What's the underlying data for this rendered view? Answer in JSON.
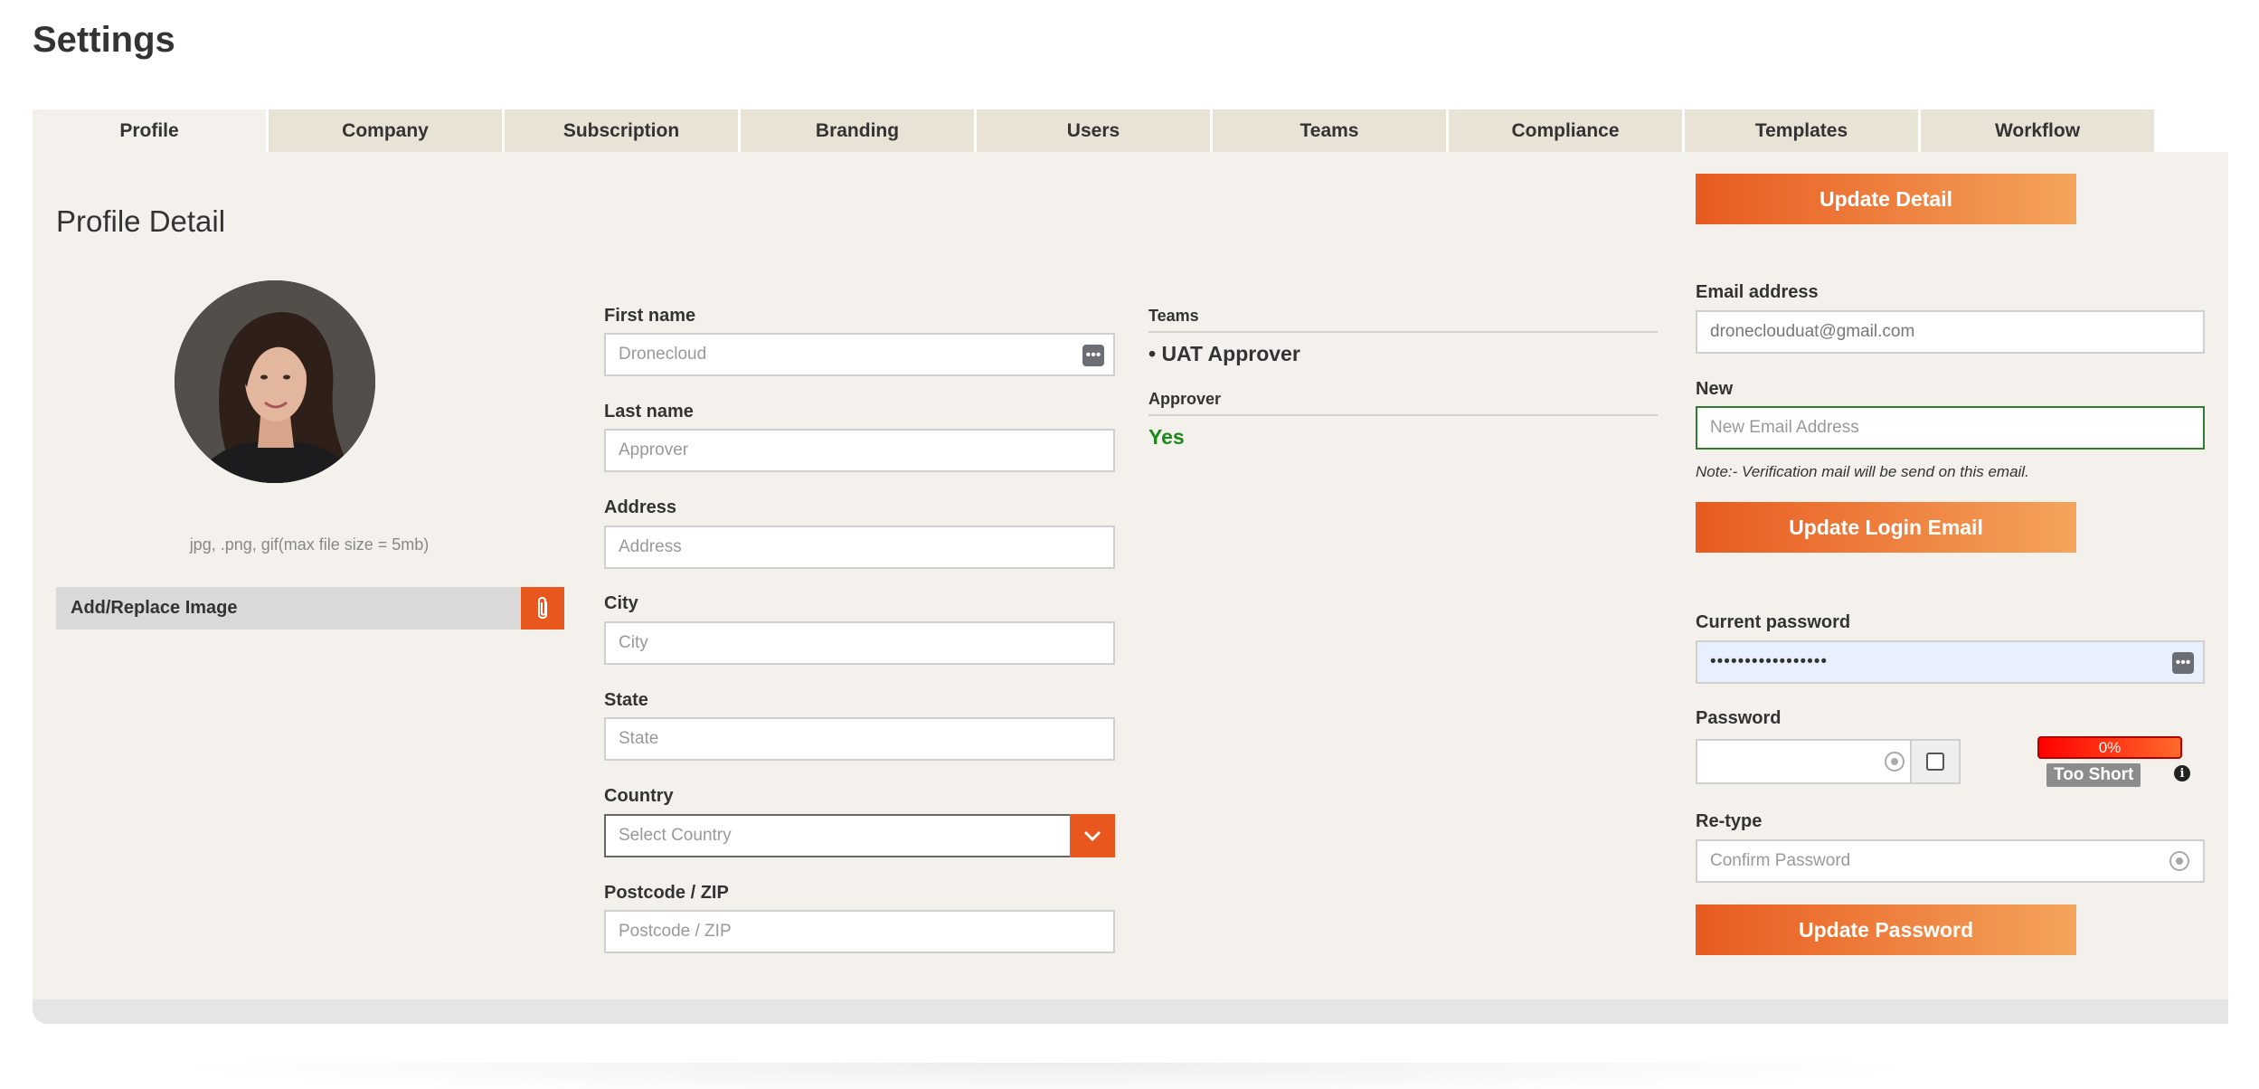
{
  "page": {
    "title": "Settings"
  },
  "tabs": [
    {
      "label": "Profile"
    },
    {
      "label": "Company"
    },
    {
      "label": "Subscription"
    },
    {
      "label": "Branding"
    },
    {
      "label": "Users"
    },
    {
      "label": "Teams"
    },
    {
      "label": "Compliance"
    },
    {
      "label": "Templates"
    },
    {
      "label": "Workflow"
    }
  ],
  "active_tab": "Profile",
  "profile": {
    "section_title": "Profile Detail",
    "file_hint": "jpg, .png, gif(max file size = 5mb)",
    "upload_label": "Add/Replace Image",
    "upload_icon": "paperclip-icon"
  },
  "form": {
    "first_name": {
      "label": "First name",
      "placeholder": "Dronecloud"
    },
    "last_name": {
      "label": "Last name",
      "placeholder": "Approver"
    },
    "address": {
      "label": "Address",
      "placeholder": "Address"
    },
    "city": {
      "label": "City",
      "placeholder": "City"
    },
    "state": {
      "label": "State",
      "placeholder": "State"
    },
    "country": {
      "label": "Country",
      "placeholder": "Select Country"
    },
    "postcode": {
      "label": "Postcode / ZIP",
      "placeholder": "Postcode / ZIP"
    }
  },
  "teams": {
    "label": "Teams",
    "value": "• UAT Approver",
    "approver_label": "Approver",
    "approver_value": "Yes"
  },
  "account": {
    "update_detail_label": "Update Detail",
    "email_label": "Email address",
    "email_value": "droneclouduat@gmail.com",
    "new_email_label": "New",
    "new_email_placeholder": "New Email Address",
    "note": "Note:- Verification mail will be send on this email.",
    "update_email_label": "Update Login Email",
    "current_password_label": "Current password",
    "current_password_value": "•••••••••••••••••",
    "password_label": "Password",
    "strength_percent": "0%",
    "strength_text": "Too Short",
    "retype_label": "Re-type",
    "retype_placeholder": "Confirm Password",
    "update_password_label": "Update Password"
  },
  "colors": {
    "accent_orange": "#e8571e",
    "panel_bg": "#f4f1ec",
    "tab_bg": "#e9e3d6",
    "success_green": "#1a8a1a"
  }
}
